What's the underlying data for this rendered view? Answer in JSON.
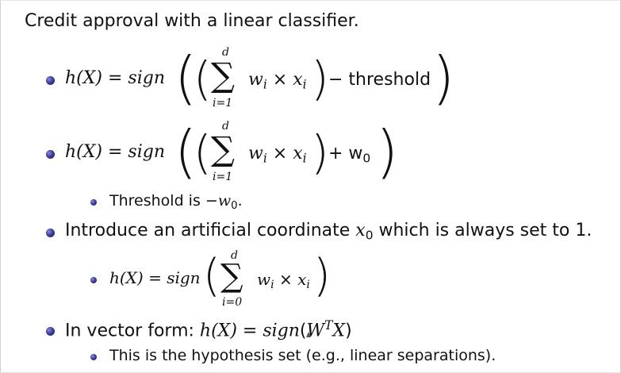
{
  "title": "Credit approval with a linear classifier.",
  "eq1": {
    "lhs": "h(X) = ",
    "sign": "sign",
    "sum_upper": "d",
    "sum_lower": "i=1",
    "term": "w",
    "term_sub": "i",
    "times": " × ",
    "var": "x",
    "var_sub": "i",
    "tail": " − threshold"
  },
  "eq2": {
    "lhs": "h(X) = ",
    "sign": "sign",
    "sum_upper": "d",
    "sum_lower": "i=1",
    "term": "w",
    "term_sub": "i",
    "times": " × ",
    "var": "x",
    "var_sub": "i",
    "tail": " + w",
    "tail_sub": "0"
  },
  "sub1": {
    "text": "Threshold is −",
    "var": "w",
    "var_sub": "0",
    "end": "."
  },
  "bullet3": {
    "text": "Introduce an artificial coordinate ",
    "var": "x",
    "var_sub": "0",
    "end": " which is always set to 1."
  },
  "eq3": {
    "lhs": "h(X) = ",
    "sign": "sign",
    "sum_upper": "d",
    "sum_lower": "i=0",
    "term": "w",
    "term_sub": "i",
    "times": " × ",
    "var": "x",
    "var_sub": "i"
  },
  "bullet4": {
    "text": "In vector form: ",
    "lhs": "h(X) = ",
    "sign": "sign",
    "arg_open": "(",
    "W": "W",
    "T": "T",
    "X": "X",
    "arg_close": ")"
  },
  "sub2": {
    "text": "This is the hypothesis set (e.g., linear separations)."
  }
}
